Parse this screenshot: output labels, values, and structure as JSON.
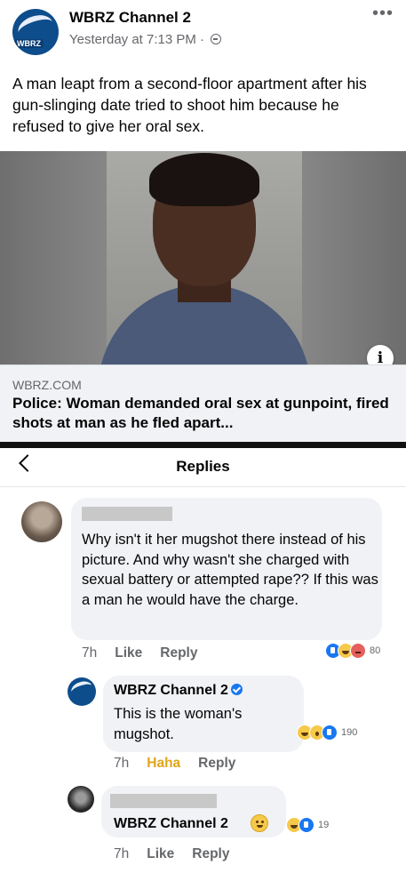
{
  "post": {
    "page_name": "WBRZ Channel 2",
    "avatar_badge": "WBRZ",
    "timestamp": "Yesterday at 7:13 PM",
    "separator": " · ",
    "privacy_icon": "globe-icon",
    "more_icon": "ellipsis-icon",
    "text": "A man leapt from a second-floor apartment after his gun-slinging date tried to shoot him because he refused to give her oral sex.",
    "photo_icon": "mugshot-photo",
    "info_glyph": "i",
    "link": {
      "domain": "WBRZ.COM",
      "title": "Police: Woman demanded oral sex at gunpoint, fired shots at man as he fled apart..."
    }
  },
  "replies_panel": {
    "back_icon": "chevron-left-icon",
    "title": "Replies"
  },
  "comments": [
    {
      "name_redacted": true,
      "text": "Why isn't it her mugshot there instead of his picture. And why wasn't she charged with sexual battery or attempted rape?? If this was a man he would have the charge.",
      "time": "7h",
      "like_label": "Like",
      "reply_label": "Reply",
      "reactions": [
        "like",
        "haha",
        "angry"
      ],
      "reaction_count": "80"
    },
    {
      "name": "WBRZ Channel 2",
      "verified": true,
      "text": "This is the woman's mugshot.",
      "time": "7h",
      "like_label": "Haha",
      "reply_label": "Reply",
      "reactions": [
        "haha",
        "wow",
        "like"
      ],
      "reaction_count": "190"
    },
    {
      "name_redacted": true,
      "name": "WBRZ Channel 2",
      "time": "7h",
      "like_label": "Like",
      "reply_label": "Reply",
      "reactions": [
        "haha",
        "like"
      ],
      "reaction_count": "19"
    }
  ],
  "colors": {
    "link_blue": "#1877f2",
    "brand_navy": "#0d4d8c",
    "bubble_gray": "#f0f2f5",
    "haha_yellow": "#e0a51a"
  }
}
